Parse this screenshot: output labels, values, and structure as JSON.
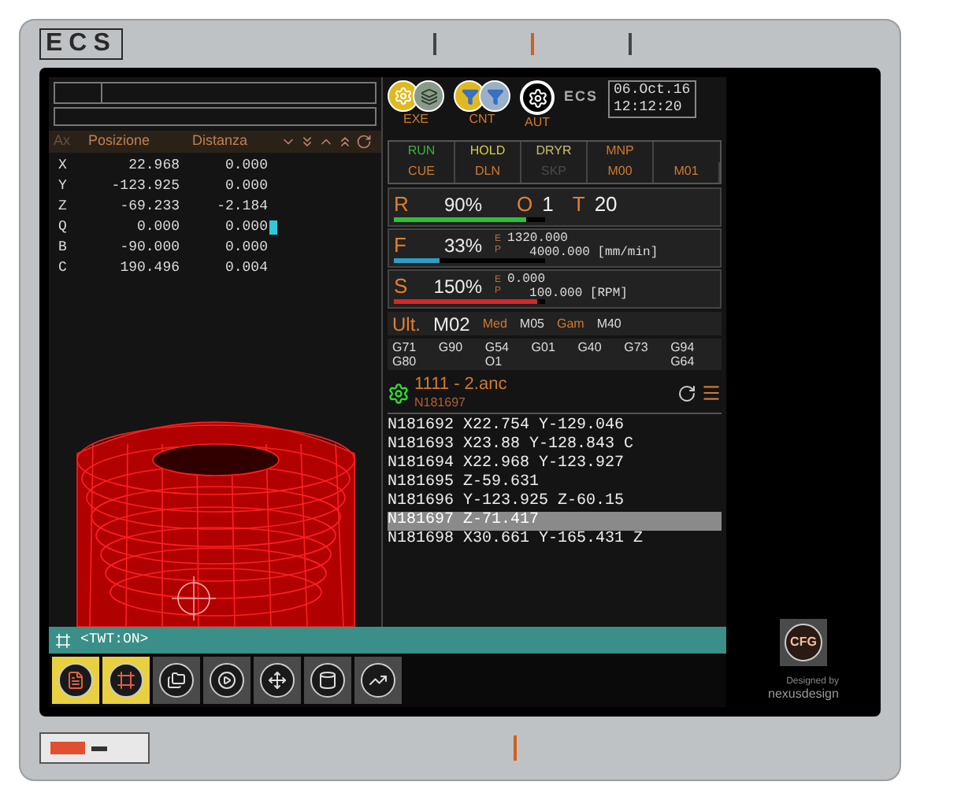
{
  "bezel": {
    "logo": "ECS",
    "designer": {
      "caption": "Designed by",
      "name": "nexusdesign"
    }
  },
  "axes_table": {
    "columns": [
      "Ax",
      "Posizione",
      "Distanza"
    ],
    "rows": [
      [
        "X",
        "22.968",
        "0.000"
      ],
      [
        "Y",
        "-123.925",
        "0.000"
      ],
      [
        "Z",
        "-69.233",
        "-2.184"
      ],
      [
        "Q",
        "0.000",
        "0.000"
      ],
      [
        "B",
        "-90.000",
        "0.000"
      ],
      [
        "C",
        "190.496",
        "0.004"
      ]
    ]
  },
  "modes": [
    {
      "label": "EXE",
      "kind": "exe"
    },
    {
      "label": "CNT",
      "kind": "cnt"
    },
    {
      "label": "AUT",
      "kind": "aut"
    }
  ],
  "screen_logo": "ECS",
  "date": "06.Oct.16",
  "time": "12:12:20",
  "status": [
    [
      {
        "label": "RUN",
        "kind": "run"
      },
      {
        "label": "HOLD",
        "kind": "hold"
      },
      {
        "label": "DRYR",
        "kind": "dry"
      },
      {
        "label": "MNP",
        "kind": "flag"
      }
    ],
    [
      {
        "label": "CUE",
        "kind": "flag"
      },
      {
        "label": "DLN",
        "kind": "flag"
      },
      {
        "label": "SKP",
        "kind": "off"
      },
      {
        "label": "M00",
        "kind": "flag"
      },
      {
        "label": "M01",
        "kind": "flag"
      }
    ]
  ],
  "overrides": [
    {
      "kind": "rapid",
      "letter": "R",
      "percent": "90%",
      "level": 0.88,
      "color": "#2fbf3a",
      "o_label": "O",
      "o_value": "1",
      "t_label": "T",
      "t_value": "20"
    },
    {
      "kind": "feed",
      "letter": "F",
      "percent": "33%",
      "level": 0.3,
      "color": "#2aa0c8",
      "flags": [
        "E",
        "P"
      ],
      "values": [
        "1320.000",
        "4000.000 [mm/min]"
      ]
    },
    {
      "kind": "feed",
      "letter": "S",
      "percent": "150%",
      "level": 0.95,
      "color": "#d02a2a",
      "flags": [
        "E",
        "P"
      ],
      "values": [
        "0.000",
        "100.000 [RPM]"
      ]
    }
  ],
  "ult": {
    "label": "Ult.",
    "code": "M02",
    "items": [
      {
        "label": "Med",
        "kind": "tag"
      },
      {
        "label": "M05",
        "kind": "code"
      },
      {
        "label": "Gam",
        "kind": "tag"
      },
      {
        "label": "M40",
        "kind": "code"
      }
    ]
  },
  "gcodes": [
    [
      "G71",
      "G80"
    ],
    [
      "G90"
    ],
    [
      "G54",
      "O1"
    ],
    [
      "G01"
    ],
    [
      "G40"
    ],
    [
      "G73"
    ],
    [
      "G94",
      "G64"
    ]
  ],
  "program": {
    "name": "1111 - 2.anc",
    "block": "N181697",
    "lines": [
      {
        "text": "N181692 X22.754 Y-129.046",
        "selected": false
      },
      {
        "text": "N181693 X23.88 Y-128.843 C",
        "selected": false
      },
      {
        "text": "N181694 X22.968 Y-123.927",
        "selected": false
      },
      {
        "text": "N181695 Z-59.631",
        "selected": false
      },
      {
        "text": "N181696 Y-123.925 Z-60.15",
        "selected": false
      },
      {
        "text": "N181697 Z-71.417",
        "selected": true
      },
      {
        "text": "N181698 X30.661 Y-165.431 Z",
        "selected": false
      }
    ]
  },
  "message_bar": "<TWT:ON>",
  "toolbar": [
    {
      "kind": "document",
      "selected": true
    },
    {
      "kind": "frame",
      "selected": true
    },
    {
      "kind": "folders",
      "selected": false
    },
    {
      "kind": "play",
      "selected": false
    },
    {
      "kind": "axes",
      "selected": false
    },
    {
      "kind": "coil",
      "selected": false
    },
    {
      "kind": "chart",
      "selected": false
    }
  ],
  "cfg_button": "CFG"
}
